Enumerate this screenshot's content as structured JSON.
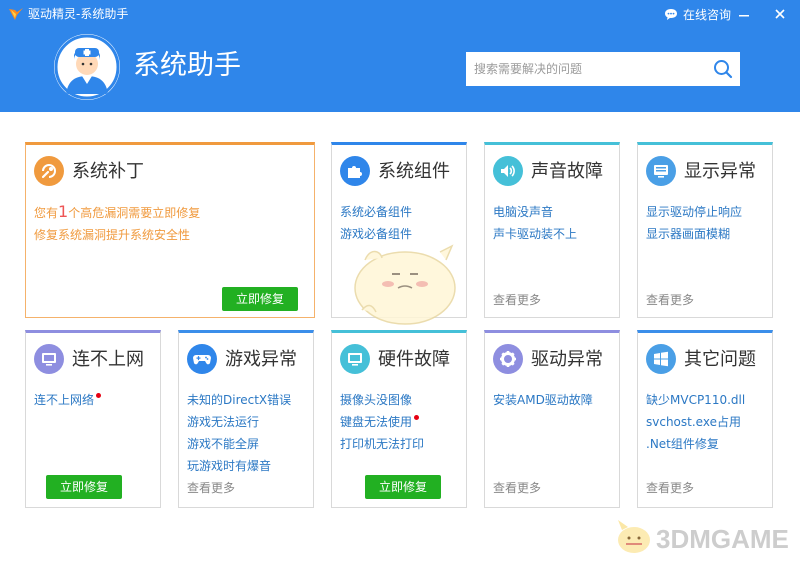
{
  "window": {
    "title": "驱动精灵-系统助手",
    "chat_label": "在线咨询"
  },
  "header": {
    "title": "系统助手",
    "search_placeholder": "搜索需要解决的问题"
  },
  "cards": {
    "patch": {
      "title": "系统补丁",
      "line1_prefix": "您有",
      "line1_count": "1",
      "line1_suffix": "个高危漏洞需要立即修复",
      "line2": "修复系统漏洞提升系统安全性",
      "button": "立即修复"
    },
    "components": {
      "title": "系统组件",
      "items": [
        "系统必备组件",
        "游戏必备组件"
      ]
    },
    "sound": {
      "title": "声音故障",
      "items": [
        "电脑没声音",
        "声卡驱动装不上"
      ],
      "more": "查看更多"
    },
    "display": {
      "title": "显示异常",
      "items": [
        "显示驱动停止响应",
        "显示器画面模糊"
      ],
      "more": "查看更多"
    },
    "network": {
      "title": "连不上网",
      "items": [
        "连不上网络"
      ],
      "button": "立即修复"
    },
    "game": {
      "title": "游戏异常",
      "items": [
        "未知的DirectX错误",
        "游戏无法运行",
        "游戏不能全屏",
        "玩游戏时有爆音"
      ],
      "more": "查看更多"
    },
    "hardware": {
      "title": "硬件故障",
      "items": [
        "摄像头没图像",
        "键盘无法使用",
        "打印机无法打印"
      ],
      "button": "立即修复"
    },
    "driver": {
      "title": "驱动异常",
      "items": [
        "安装AMD驱动故障"
      ],
      "more": "查看更多"
    },
    "other": {
      "title": "其它问题",
      "items": [
        "缺少MVCP110.dll",
        "svchost.exe占用",
        ".Net组件修复"
      ],
      "more": "查看更多"
    }
  },
  "watermark": {
    "text": "3DMGAME"
  },
  "colors": {
    "header_blue": "#2f86ea",
    "orange": "#f09a3e",
    "link_blue": "#2b78c4",
    "green_button": "#22b022",
    "teal": "#45c0d8",
    "purple": "#8e8ee0",
    "alert_red": "#e60012"
  }
}
